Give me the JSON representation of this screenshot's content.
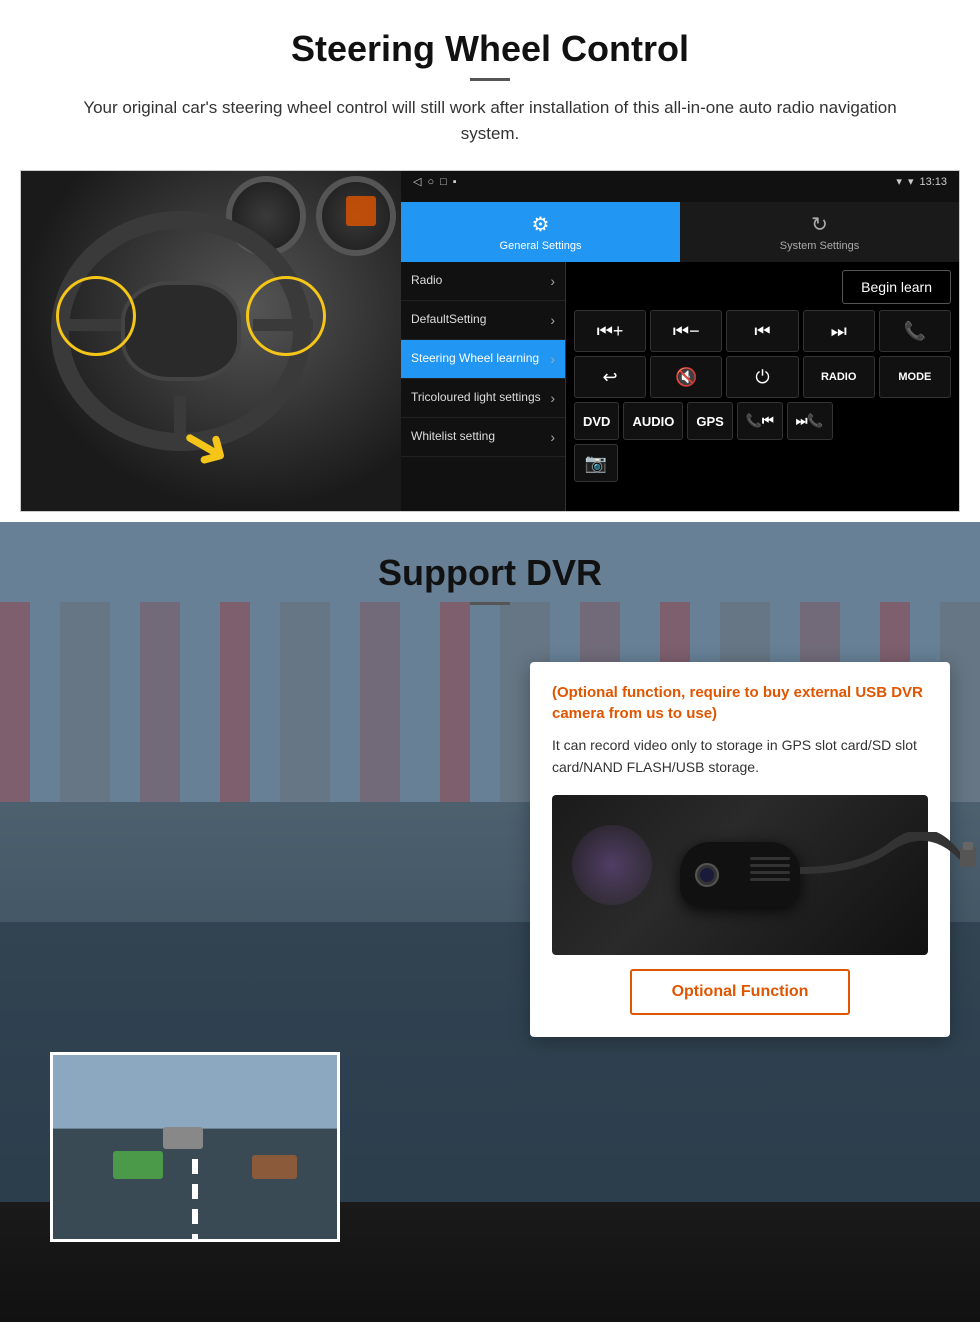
{
  "page": {
    "section1": {
      "title": "Steering Wheel Control",
      "description": "Your original car's steering wheel control will still work after installation of this all-in-one auto radio navigation system.",
      "android": {
        "status_bar": {
          "time": "13:13",
          "nav_buttons": [
            "◁",
            "○",
            "□",
            "▪"
          ]
        },
        "tabs": [
          {
            "id": "general",
            "label": "General Settings",
            "icon": "⚙",
            "active": true
          },
          {
            "id": "system",
            "label": "System Settings",
            "icon": "🔁",
            "active": false
          }
        ],
        "menu_items": [
          {
            "label": "Radio",
            "active": false
          },
          {
            "label": "DefaultSetting",
            "active": false
          },
          {
            "label": "Steering Wheel learning",
            "active": true
          },
          {
            "label": "Tricoloured light settings",
            "active": false
          },
          {
            "label": "Whitelist setting",
            "active": false
          }
        ],
        "begin_learn_label": "Begin learn",
        "control_buttons_row1": [
          "⏮+",
          "⏮-",
          "⏮⏮",
          "⏭⏭",
          "📞"
        ],
        "control_buttons_row2": [
          "↩",
          "🔇",
          "⏻",
          "RADIO",
          "MODE"
        ],
        "control_buttons_row3": [
          "DVD",
          "AUDIO",
          "GPS",
          "📞⏮",
          "⏭📞"
        ],
        "control_buttons_row4_icon": "📷"
      }
    },
    "section2": {
      "title": "Support DVR",
      "card": {
        "orange_text": "(Optional function, require to buy external USB DVR camera from us to use)",
        "body_text": "It can record video only to storage in GPS slot card/SD slot card/NAND FLASH/USB storage."
      },
      "optional_function_label": "Optional Function"
    }
  }
}
